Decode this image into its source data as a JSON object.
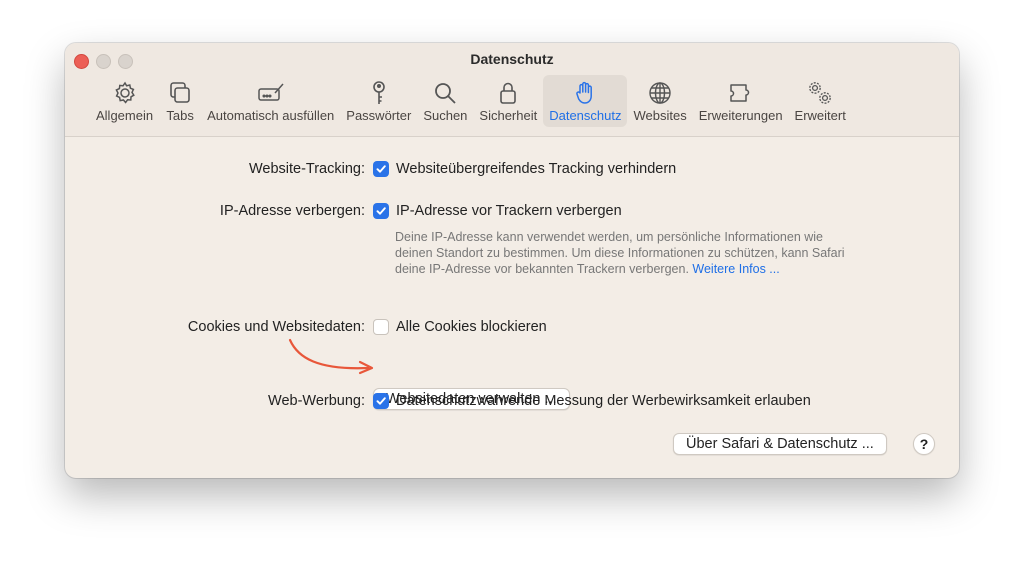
{
  "window": {
    "title": "Datenschutz"
  },
  "tabs": [
    {
      "label": "Allgemein",
      "icon": "gear-icon"
    },
    {
      "label": "Tabs",
      "icon": "tabs-icon"
    },
    {
      "label": "Automatisch ausfüllen",
      "icon": "autofill-icon"
    },
    {
      "label": "Passwörter",
      "icon": "key-icon"
    },
    {
      "label": "Suchen",
      "icon": "search-icon"
    },
    {
      "label": "Sicherheit",
      "icon": "lock-icon"
    },
    {
      "label": "Datenschutz",
      "icon": "hand-icon",
      "active": true
    },
    {
      "label": "Websites",
      "icon": "globe-icon"
    },
    {
      "label": "Erweiterungen",
      "icon": "puzzle-icon"
    },
    {
      "label": "Erweitert",
      "icon": "gears-icon"
    }
  ],
  "settings": {
    "tracking": {
      "label": "Website-Tracking:",
      "option": "Websiteübergreifendes Tracking verhindern",
      "checked": true
    },
    "ip": {
      "label": "IP-Adresse verbergen:",
      "option": "IP-Adresse vor Trackern verbergen",
      "checked": true,
      "description": "Deine IP-Adresse kann verwendet werden, um persönliche Informationen wie deinen Standort zu bestimmen. Um diese Informationen zu schützen, kann Safari deine IP-Adresse vor bekannten Trackern verbergen.",
      "link": "Weitere Infos ..."
    },
    "cookies": {
      "label": "Cookies und Websitedaten:",
      "option": "Alle Cookies blockieren",
      "checked": false,
      "manage_button": "Websitedaten verwalten ..."
    },
    "ads": {
      "label": "Web-Werbung:",
      "option": "Datenschutzwahrende Messung der Werbewirksamkeit erlauben",
      "checked": true
    }
  },
  "footer": {
    "about_button": "Über Safari & Datenschutz ...",
    "help_button": "?"
  },
  "colors": {
    "accent": "#2a73e8",
    "annotation_arrow": "#e8573a"
  }
}
